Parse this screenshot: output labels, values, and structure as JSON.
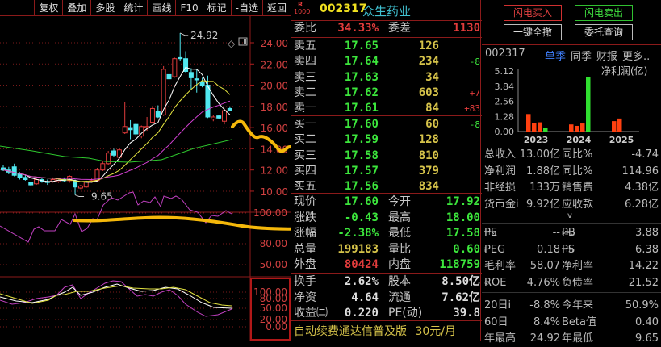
{
  "toolbar": [
    "复权",
    "叠加",
    "多股",
    "统计",
    "画线",
    "F10",
    "标记",
    "-自选",
    "返回"
  ],
  "chart": {
    "high_label": "24.92",
    "low_label": "9.65",
    "price_ticks": [
      "24.00",
      "22.00",
      "20.00",
      "18.00",
      "16.00",
      "14.00",
      "12.00",
      "10.00"
    ],
    "ind1_ticks": [
      "100.00",
      "80.00",
      "50.00"
    ],
    "ind2_ticks": [
      "100.00",
      "80.00",
      "50.00",
      "20.00",
      "0.00"
    ],
    "candles": [
      [
        12.2,
        12.5,
        11.9,
        12.0
      ],
      [
        12.0,
        12.3,
        11.6,
        11.8
      ],
      [
        12.3,
        12.6,
        11.4,
        11.5
      ],
      [
        11.6,
        11.8,
        11.1,
        11.3
      ],
      [
        11.3,
        11.5,
        11.0,
        11.1
      ],
      [
        10.8,
        10.9,
        10.5,
        10.6
      ],
      [
        10.7,
        11.2,
        10.6,
        11.1
      ],
      [
        11.1,
        11.3,
        10.8,
        10.9
      ],
      [
        10.9,
        11.1,
        10.6,
        10.9
      ],
      [
        10.9,
        11.3,
        10.8,
        11.1
      ],
      [
        10.9,
        11.2,
        10.8,
        11.2
      ],
      [
        11.1,
        11.3,
        10.9,
        11.0
      ],
      [
        11.0,
        11.5,
        10.8,
        11.4
      ],
      [
        11.0,
        11.1,
        9.65,
        10.4
      ],
      [
        10.3,
        10.6,
        10.2,
        10.5
      ],
      [
        10.4,
        11.0,
        10.3,
        10.9
      ],
      [
        10.9,
        11.2,
        10.8,
        11.0
      ],
      [
        11.0,
        12.2,
        10.9,
        12.0
      ],
      [
        12.0,
        12.8,
        11.9,
        12.6
      ],
      [
        12.6,
        13.8,
        12.5,
        13.6
      ],
      [
        13.8,
        14.0,
        13.2,
        13.4
      ],
      [
        13.2,
        14.1,
        13.0,
        13.9
      ],
      [
        15.5,
        18.4,
        15.4,
        16.1
      ],
      [
        16.0,
        16.7,
        14.9,
        15.8
      ],
      [
        16.3,
        16.4,
        15.1,
        15.4
      ],
      [
        15.2,
        16.2,
        15.0,
        16.1
      ],
      [
        16.0,
        17.0,
        15.7,
        16.1
      ],
      [
        16.5,
        18.0,
        16.4,
        17.8
      ],
      [
        17.5,
        18.1,
        16.9,
        17.0
      ],
      [
        17.2,
        21.8,
        17.1,
        21.5
      ],
      [
        21.0,
        21.6,
        20.5,
        20.6
      ],
      [
        20.8,
        22.6,
        20.7,
        22.5
      ],
      [
        22.6,
        24.92,
        22.3,
        22.5
      ],
      [
        22.5,
        23.2,
        21.2,
        21.3
      ],
      [
        21.2,
        21.6,
        19.6,
        20.7
      ],
      [
        20.6,
        21.5,
        19.3,
        20.5
      ],
      [
        20.3,
        20.7,
        19.8,
        20.0
      ],
      [
        20.0,
        20.9,
        16.9,
        17.0
      ],
      [
        16.8,
        17.2,
        16.6,
        17.0
      ],
      [
        17.1,
        17.2,
        16.8,
        16.9
      ],
      [
        16.6,
        17.8,
        16.3,
        17.6
      ],
      [
        17.8,
        18.0,
        17.58,
        17.6
      ]
    ]
  },
  "quote": {
    "badge_r": "R",
    "badge_n": "1000",
    "code": "002317",
    "name": "众生药业",
    "weibi_label": "委比",
    "weibi": "34.33%",
    "weicha_label": "委差",
    "weicha": "1130",
    "asks": [
      {
        "l": "卖五",
        "p": "17.65",
        "v": "126",
        "d": ""
      },
      {
        "l": "卖四",
        "p": "17.64",
        "v": "234",
        "d": "-8"
      },
      {
        "l": "卖三",
        "p": "17.63",
        "v": "34",
        "d": ""
      },
      {
        "l": "卖二",
        "p": "17.62",
        "v": "603",
        "d": "+7"
      },
      {
        "l": "卖一",
        "p": "17.61",
        "v": "84",
        "d": "+83"
      }
    ],
    "bids": [
      {
        "l": "买一",
        "p": "17.60",
        "v": "60",
        "d": "-8"
      },
      {
        "l": "买二",
        "p": "17.59",
        "v": "128",
        "d": ""
      },
      {
        "l": "买三",
        "p": "17.58",
        "v": "810",
        "d": ""
      },
      {
        "l": "买四",
        "p": "17.57",
        "v": "379",
        "d": ""
      },
      {
        "l": "买五",
        "p": "17.56",
        "v": "834",
        "d": ""
      }
    ],
    "stats": [
      {
        "l": "现价",
        "v": "17.60",
        "l2": "今开",
        "v2": "17.92"
      },
      {
        "l": "涨跌",
        "v": "-0.43",
        "l2": "最高",
        "v2": "18.00"
      },
      {
        "l": "涨幅",
        "v": "-2.38%",
        "l2": "最低",
        "v2": "17.58"
      },
      {
        "l": "总量",
        "v": "199183",
        "l2": "量比",
        "v2": "0.60"
      },
      {
        "l": "外盘",
        "v": "80424",
        "l2": "内盘",
        "v2": "118759"
      }
    ],
    "info": [
      {
        "l": "换手",
        "v": "2.62%",
        "l2": "股本",
        "v2": "8.50亿"
      },
      {
        "l": "净资",
        "v": "4.64",
        "l2": "流通",
        "v2": "7.62亿"
      },
      {
        "l": "收益㈡",
        "v": "0.220",
        "l2": "PE(动)",
        "v2": "39.8"
      }
    ],
    "ad": "自动续费通达信普及版",
    "ad_price": "30元/月"
  },
  "right": {
    "buttons": {
      "flash_buy": "闪电买入",
      "flash_sell": "闪电卖出",
      "cancel_all": "一键全撤",
      "order_query": "委托查询"
    },
    "code": "002317",
    "tabs": [
      "单季",
      "同季",
      "财报",
      "更多.."
    ],
    "fin_chart": {
      "type": "bar",
      "title": "净利润(亿)",
      "yticks": [
        "5.12",
        "3.84",
        "2.56",
        "1.28",
        "0.00"
      ],
      "ylim": [
        0,
        5.12
      ],
      "groups": [
        {
          "year": "2023",
          "values": [
            1.48,
            0.75,
            0.78,
            0.28
          ]
        },
        {
          "year": "2024",
          "values": [
            0.6,
            0.48,
            0.68,
            4.6
          ]
        },
        {
          "year": "2025",
          "values": [
            0.88,
            1.1
          ]
        }
      ],
      "colors": {
        "normal": "#ff4010",
        "q4": "#30e030"
      }
    },
    "fin": [
      {
        "l": "总收入",
        "v": "13.00亿",
        "l2": "同比%",
        "v2": "-4.74"
      },
      {
        "l": "净利润",
        "v": "1.88亿",
        "l2": "同比%",
        "v2": "114.96"
      },
      {
        "l": "非经损",
        "v": "133万",
        "l2": "销售费",
        "v2": "4.38亿"
      },
      {
        "l": "货币金i",
        "v": "9.92亿",
        "l2": "应收款",
        "v2": "6.28亿"
      }
    ],
    "expand": "v",
    "val": [
      {
        "l": "PE",
        "s": "TTM",
        "v": "--",
        "l2": "PB",
        "s2": "MRQ",
        "v2": "3.88"
      },
      {
        "l": "PEG",
        "s": "i",
        "v": "0.18",
        "l2": "PS",
        "s2": "TTM",
        "v2": "6.38"
      },
      {
        "l": "毛利率",
        "s": "",
        "v": "58.07",
        "l2": "净利率",
        "s2": "",
        "v2": "14.22"
      },
      {
        "l": "ROE",
        "s": "②",
        "v": "4.76%",
        "l2": "负债率",
        "s2": "",
        "v2": "21.52"
      }
    ],
    "perf": [
      {
        "l": "20日i",
        "v": "-8.8%",
        "l2": "今年来",
        "v2": "50.9%"
      },
      {
        "l": "60日",
        "v": "8.4%",
        "l2": "Beta值",
        "v2": "0.40"
      },
      {
        "l": "年最高",
        "v": "24.92",
        "l2": "年最低",
        "v2": "9.65"
      }
    ]
  }
}
